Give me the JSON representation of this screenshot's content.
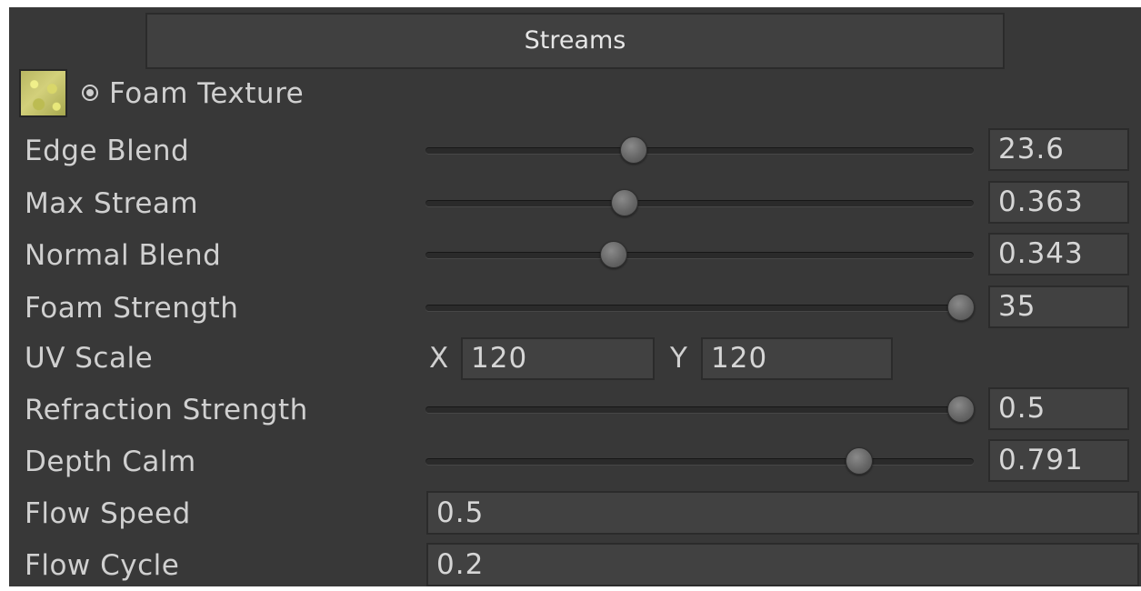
{
  "header": {
    "title": "Streams"
  },
  "foam_texture": {
    "label": "Foam Texture",
    "icon": "object-picker-icon"
  },
  "sliders": [
    {
      "label": "Edge Blend",
      "value": "23.6",
      "fraction": 0.38
    },
    {
      "label": "Max Stream",
      "value": "0.363",
      "fraction": 0.363
    },
    {
      "label": "Normal Blend",
      "value": "0.343",
      "fraction": 0.343
    },
    {
      "label": "Foam Strength",
      "value": "35",
      "fraction": 0.977
    },
    {
      "label": "Refraction Strength",
      "value": "0.5",
      "fraction": 0.977
    },
    {
      "label": "Depth Calm",
      "value": "0.791",
      "fraction": 0.791
    }
  ],
  "uv_scale": {
    "label": "UV Scale",
    "x_label": "X",
    "x_value": "120",
    "y_label": "Y",
    "y_value": "120"
  },
  "flow_speed": {
    "label": "Flow Speed",
    "value": "0.5"
  },
  "flow_cycle": {
    "label": "Flow Cycle",
    "value": "0.2"
  }
}
